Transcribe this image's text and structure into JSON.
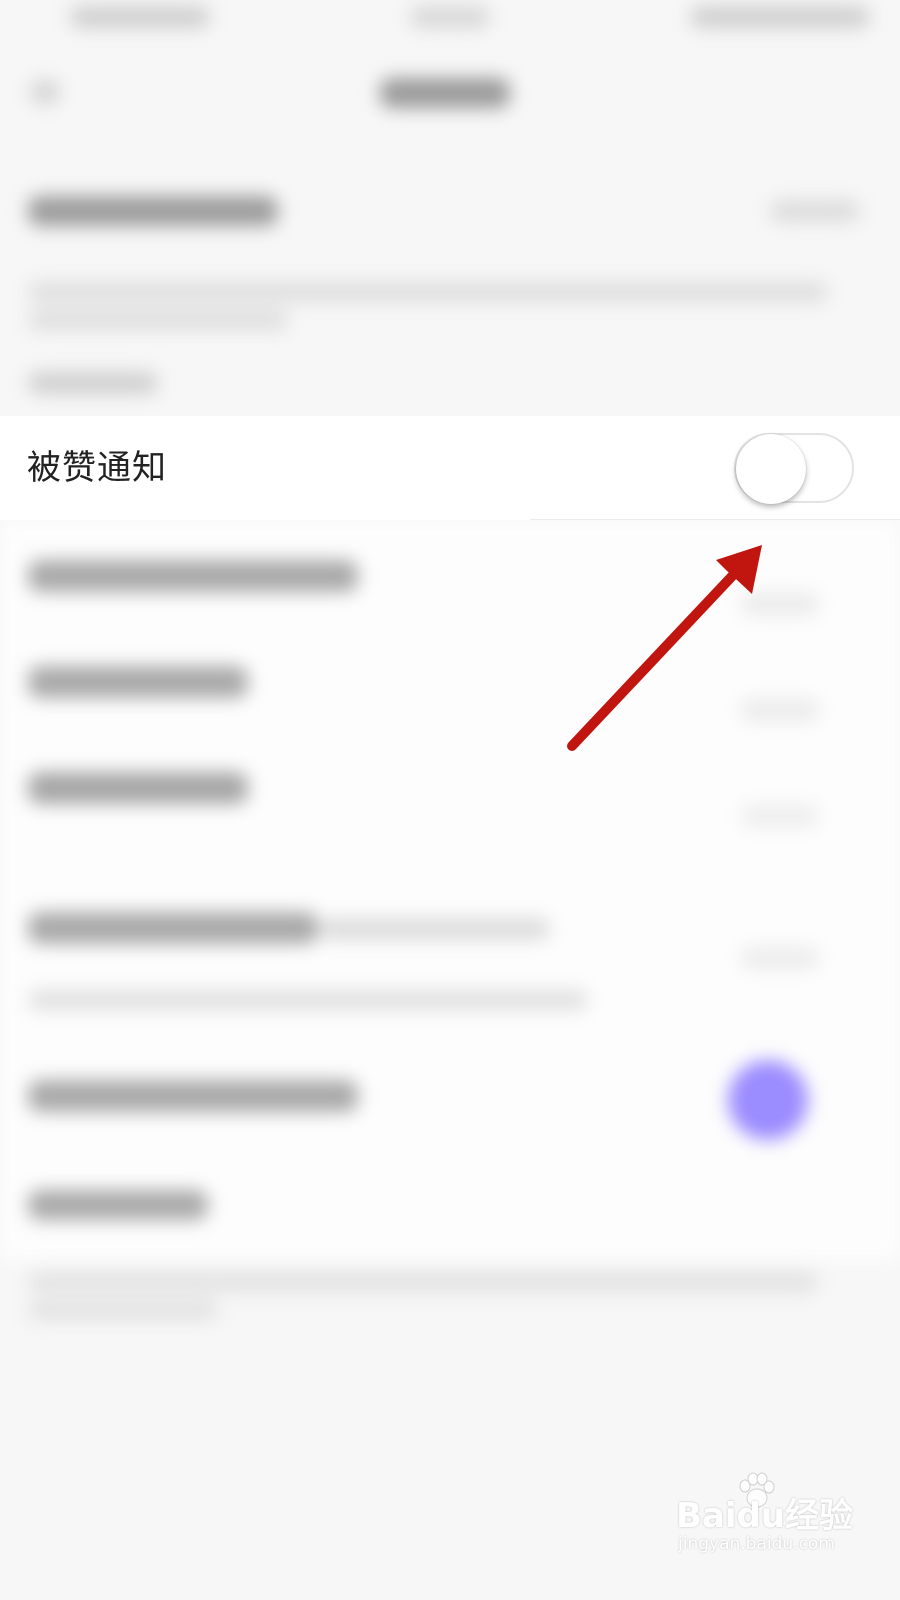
{
  "setting_row": {
    "label": "被赞通知",
    "toggle_on": false
  },
  "annotation": {
    "arrow_color": "#c0160f",
    "arrow_icon": "red-arrow-pointing-to-toggle"
  },
  "watermark": {
    "logo_text": "Baidu经验",
    "url": "jingyan.baidu.com"
  },
  "colors": {
    "background": "#f7f7f7",
    "row_background": "#ffffff",
    "blurred_accent": "#9b8cff"
  }
}
